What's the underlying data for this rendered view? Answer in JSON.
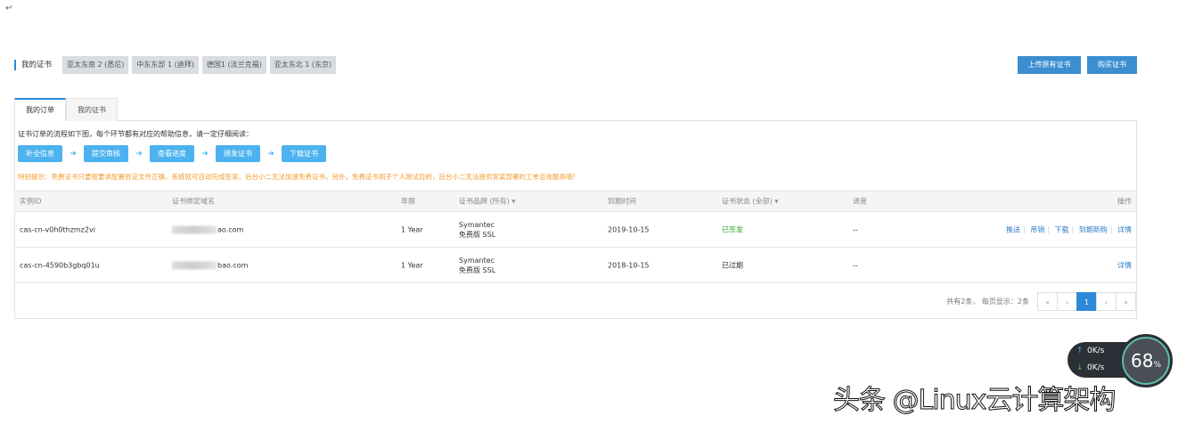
{
  "return_mark": "↵",
  "header": {
    "my_cert": "我的证书",
    "regions": [
      "亚太东南 2 (悉尼)",
      "中东东部 1 (迪拜)",
      "德国1 (法兰克福)",
      "亚太东北 1 (东京)"
    ],
    "upload_button": "上传原有证书",
    "buy_button": "购买证书"
  },
  "tabs": [
    "我的订单",
    "我的证书"
  ],
  "flow": {
    "intro": "证书订单的流程如下图，每个环节都有对应的帮助信息，请一定仔细阅读：",
    "steps": [
      "补全信息",
      "提交审核",
      "查看进度",
      "颁发证书",
      "下载证书"
    ],
    "arrow": "➜"
  },
  "warning": "特别提示：免费证书只要按要求配置验证文件正确，系统就可自动完成签发，后台小二无法加速免费证书，另外，免费证书用于个人测试目的，后台小二无法提供安装部署的工单咨询服务哦!",
  "table": {
    "headers": [
      "实例ID",
      "证书绑定域名",
      "年限",
      "证书品牌 (所有) ▾",
      "到期时间",
      "证书状态 (全部) ▾",
      "进度",
      "操作"
    ],
    "rows": [
      {
        "id": "cas-cn-v0h0thzmz2vi",
        "domain": "ao.com",
        "period": "1 Year",
        "brand": "Symantec",
        "brand_type": "免费版 SSL",
        "expiry": "2019-10-15",
        "status": "已签发",
        "progress": "--",
        "actions": [
          "推送",
          "吊销",
          "下载",
          "到期新购",
          "详情"
        ]
      },
      {
        "id": "cas-cn-4590b3gbq01u",
        "domain": "bao.com",
        "period": "1 Year",
        "brand": "Symantec",
        "brand_type": "免费版 SSL",
        "expiry": "2018-10-15",
        "status": "已过期",
        "progress": "--",
        "actions": [
          "详情"
        ]
      }
    ]
  },
  "pagination": {
    "info": "共有2条， 每页显示：2条",
    "first": "«",
    "prev": "‹",
    "current": "1",
    "next": "›",
    "last": "»"
  },
  "widget": {
    "up": "0K/s",
    "down": "0K/s",
    "percent": "68",
    "percent_sign": "%"
  },
  "watermark": "头条 @Linux云计算架构",
  "colors": {
    "accent": "#2e8ad8",
    "step": "#4db3f0",
    "warning": "#f39a2b",
    "success": "#3aa834"
  }
}
